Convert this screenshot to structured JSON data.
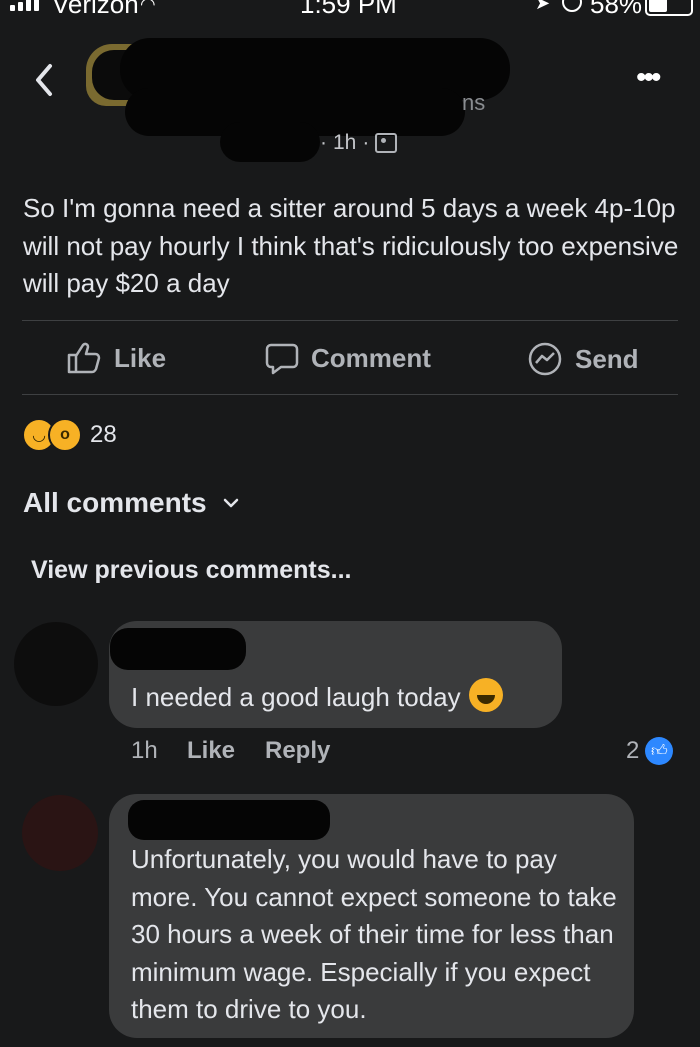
{
  "status": {
    "carrier": "Verizon",
    "time": "1:59 PM",
    "battery": "58%"
  },
  "post": {
    "name_suffix": "ns",
    "time": "1h",
    "text": "So I'm gonna need a sitter around 5 days a week 4p-10p will not pay hourly I think that's ridiculously too expensive will pay $20 a day",
    "actions": {
      "like": "Like",
      "comment": "Comment",
      "send": "Send"
    },
    "reactions": {
      "count": "28"
    }
  },
  "comments_header": {
    "label": "All comments"
  },
  "view_previous": "View previous comments...",
  "comments": [
    {
      "text": "I needed a good laugh today",
      "time": "1h",
      "like": "Like",
      "reply": "Reply",
      "like_count": "2"
    },
    {
      "text": "Unfortunately, you would have to pay more. You cannot expect someone to take 30 hours a week of their time for less than minimum wage. Especially if you expect them to drive to you."
    }
  ],
  "colors": {
    "background": "#18191a",
    "bubble": "#3a3b3c",
    "like_blue": "#2d88ff",
    "reaction_yellow": "#f7b125"
  }
}
